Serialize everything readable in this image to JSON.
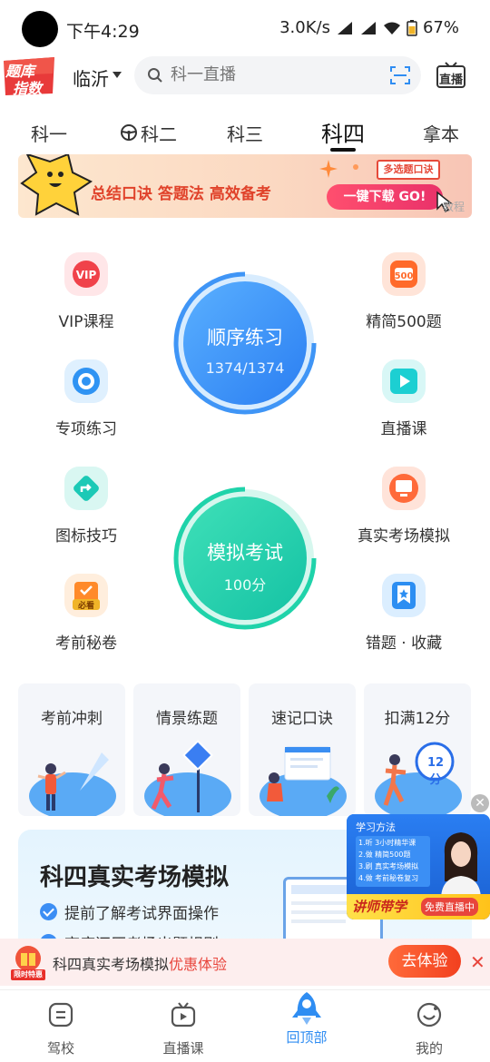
{
  "status_bar": {
    "time": "下午4:29",
    "net_speed": "3.0K/s",
    "battery": "67%"
  },
  "header": {
    "logo_line1": "题库",
    "logo_line2": "指数",
    "city": "临沂",
    "search_placeholder": "科一直播",
    "live_label": "直播"
  },
  "tabs": [
    {
      "label": "科一",
      "active": false
    },
    {
      "label": "科二",
      "active": false
    },
    {
      "label": "科三",
      "active": false
    },
    {
      "label": "科四",
      "active": true
    },
    {
      "label": "拿本",
      "active": false
    }
  ],
  "banner": {
    "slogan": "总结口诀 答题法 高效备考",
    "badge": "多选题口诀",
    "button": "一键下载  GO!",
    "tag": "教程"
  },
  "practice_grid": {
    "left": [
      {
        "label": "VIP课程",
        "icon": "vip-icon",
        "color": "#f0424a"
      },
      {
        "label": "专项练习",
        "icon": "target-icon",
        "color": "#2f93f3"
      },
      {
        "label": "图标技巧",
        "icon": "sign-icon",
        "color": "#1cc9b6"
      },
      {
        "label": "考前秘卷",
        "icon": "clipboard-icon",
        "color": "#ff8a2a"
      }
    ],
    "right": [
      {
        "label": "精简500题",
        "icon": "500-icon",
        "color": "#ff6a2a"
      },
      {
        "label": "直播课",
        "icon": "video-icon",
        "color": "#1ccfd2"
      },
      {
        "label": "真实考场模拟",
        "icon": "monitor-icon",
        "color": "#ff6a3a"
      },
      {
        "label": "错题 · 收藏",
        "icon": "bookmark-icon",
        "color": "#2c8ef2"
      }
    ]
  },
  "sequence_practice": {
    "label": "顺序练习",
    "progress": "1374/1374"
  },
  "mock_exam": {
    "label": "模拟考试",
    "score": "100分"
  },
  "cards": [
    {
      "title": "考前冲刺"
    },
    {
      "title": "情景练题"
    },
    {
      "title": "速记口诀"
    },
    {
      "title": "扣满12分",
      "badge": "12分"
    }
  ],
  "promo": {
    "title": "科四真实考场模拟",
    "points": [
      "提前了解考试界面操作",
      "高度还原考场出题规则"
    ]
  },
  "float_ad": {
    "heading": "学习方法",
    "items": [
      "1.听 3小时精华课",
      "2.做 精简500题",
      "3.刷 真实考场模拟",
      "4.做 考前秘卷复习"
    ],
    "tag": "讲师带学",
    "live": "免费直播中"
  },
  "offer": {
    "badge": "限时特惠",
    "text": "科四真实考场模拟",
    "highlight": "优惠体验",
    "button": "去体验"
  },
  "bottom_nav": [
    {
      "label": "驾校",
      "icon": "school-icon",
      "active": false
    },
    {
      "label": "直播课",
      "icon": "tv-icon",
      "active": false
    },
    {
      "label": "回顶部",
      "icon": "rocket-icon",
      "active": true
    },
    {
      "label": "我的",
      "icon": "smile-icon",
      "active": false
    }
  ]
}
